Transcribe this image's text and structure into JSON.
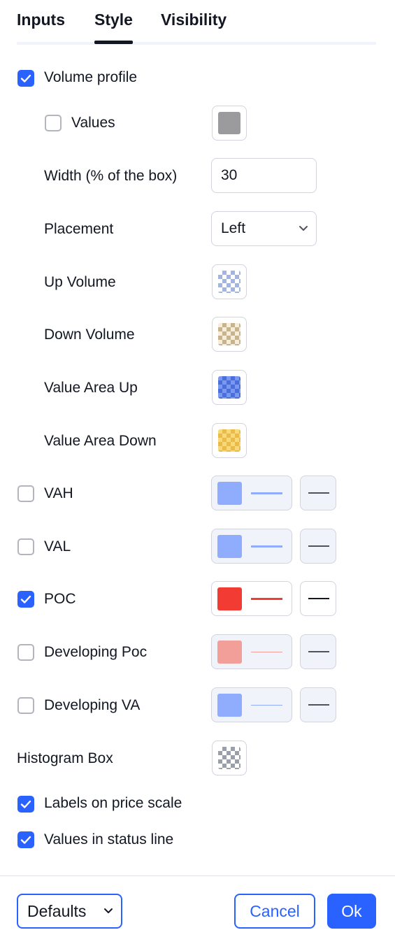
{
  "tabs": [
    {
      "label": "Inputs",
      "active": false
    },
    {
      "label": "Style",
      "active": true
    },
    {
      "label": "Visibility",
      "active": false
    }
  ],
  "volume_profile": {
    "label": "Volume profile",
    "checked": true
  },
  "values": {
    "label": "Values",
    "checked": false,
    "color": "#9b9b9e"
  },
  "width": {
    "label": "Width (% of the box)",
    "value": "30"
  },
  "placement": {
    "label": "Placement",
    "selected": "Left"
  },
  "up_volume": {
    "label": "Up Volume",
    "color": "#a3b4e0"
  },
  "down_volume": {
    "label": "Down Volume",
    "color": "#d8c8a4"
  },
  "value_area_up": {
    "label": "Value Area Up",
    "color": "#5f83e6"
  },
  "value_area_down": {
    "label": "Value Area Down",
    "color": "#f2cc64"
  },
  "vah": {
    "label": "VAH",
    "checked": false,
    "color": "#90acfc"
  },
  "val": {
    "label": "VAL",
    "checked": false,
    "color": "#90acfc"
  },
  "poc": {
    "label": "POC",
    "checked": true,
    "color": "#f23b32"
  },
  "developing_poc": {
    "label": "Developing Poc",
    "checked": false,
    "color": "#f29f9a"
  },
  "developing_va": {
    "label": "Developing VA",
    "checked": false,
    "color": "#90acfc"
  },
  "histogram_box": {
    "label": "Histogram Box",
    "color": "#9aa0aa"
  },
  "labels_on_price_scale": {
    "label": "Labels on price scale",
    "checked": true
  },
  "values_in_status_line": {
    "label": "Values in status line",
    "checked": true
  },
  "footer": {
    "defaults_label": "Defaults",
    "cancel_label": "Cancel",
    "ok_label": "Ok"
  },
  "colors": {
    "accent": "#2962ff",
    "border": "#d1d4dc",
    "disabled_bg": "#f0f3fa"
  }
}
